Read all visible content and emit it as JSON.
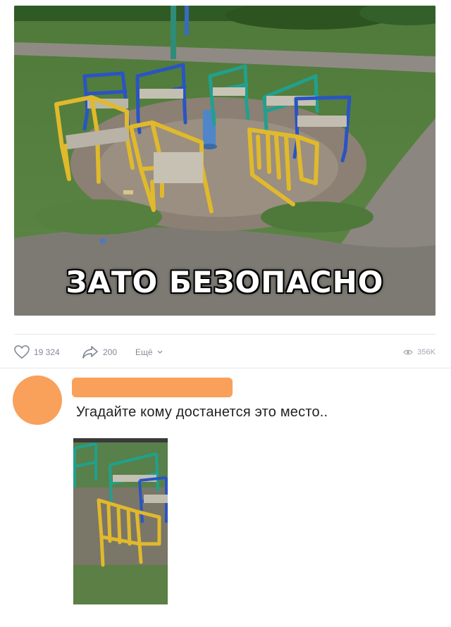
{
  "post": {
    "caption": "ЗАТО БЕЗОПАСНО",
    "image": "photo of mismatched metal chairs arranged in a circle on grass around a blue post"
  },
  "actions": {
    "likes": "19 324",
    "shares": "200",
    "more_label": "Ещё",
    "views": "356K"
  },
  "comment": {
    "text": "Угадайте кому достанется это место..",
    "image": "phone photo of a yellow chair facing green and blue chairs"
  },
  "colors": {
    "avatar": "#f9a05a",
    "name_redaction": "#f9a05a",
    "icon": "#828a99"
  },
  "icons": [
    "heart-icon",
    "share-arrow-icon",
    "chevron-down-icon",
    "eye-icon"
  ]
}
